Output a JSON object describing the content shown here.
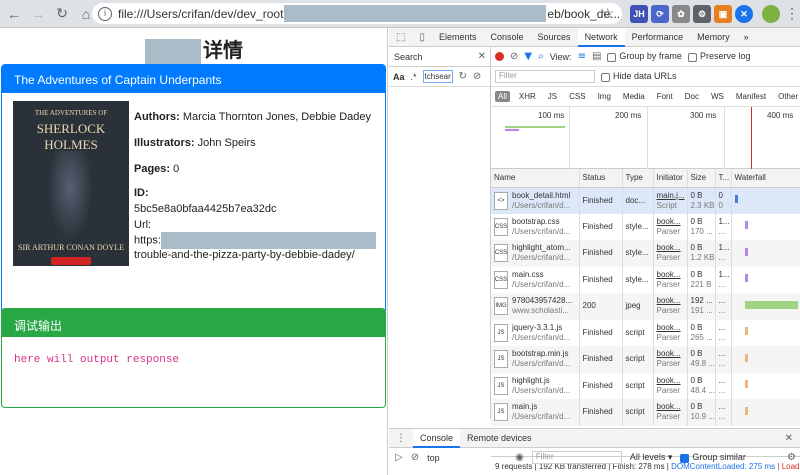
{
  "browser": {
    "url_prefix": "file:///Users/crifan/dev/dev_root",
    "url_suffix": "eb/book_de...",
    "ext_labels": [
      "JH",
      "⟳",
      "✿",
      "⚙",
      "▣",
      "✕"
    ]
  },
  "page": {
    "title": "详情",
    "book_card": {
      "header": "The Adventures of Captain Underpants",
      "cover": {
        "line1": "THE ADVENTURES OF",
        "line2": "SHERLOCK HOLMES",
        "line3": "SIR ARTHUR CONAN DOYLE"
      },
      "authors_label": "Authors:",
      "authors_value": "Marcia Thornton Jones, Debbie Dadey",
      "illustrators_label": "Illustrators:",
      "illustrators_value": "John Speirs",
      "pages_label": "Pages:",
      "pages_value": "0",
      "id_label": "ID:",
      "id_value": "5bc5e8a0bfaa4425b7ea32dc",
      "url_label": "Url:",
      "url_prefix": "https:",
      "url_suffix": "trouble-and-the-pizza-party-by-debbie-dadey/"
    },
    "debug_card": {
      "header": "调试输出",
      "body": "here will output response"
    }
  },
  "devtools": {
    "tabs": [
      "Elements",
      "Console",
      "Sources",
      "Network",
      "Performance",
      "Memory"
    ],
    "active_tab": "Network",
    "more": "»",
    "search": {
      "title": "Search",
      "aa": "Aa",
      "regex": ".*",
      "query": "tchsear"
    },
    "network": {
      "view_label": "View:",
      "group_by_frame": "Group by frame",
      "preserve_log": "Preserve log",
      "filter_placeholder": "Filter",
      "hide_data_urls": "Hide data URLs",
      "types": [
        "All",
        "XHR",
        "JS",
        "CSS",
        "Img",
        "Media",
        "Font",
        "Doc",
        "WS",
        "Manifest",
        "Other"
      ],
      "overview_ticks": [
        "100 ms",
        "200 ms",
        "300 ms",
        "400 ms"
      ],
      "columns": [
        "Name",
        "Status",
        "Type",
        "Initiator",
        "Size",
        "T...",
        "Waterfall"
      ],
      "rows": [
        {
          "icon": "<>",
          "name": "book_detail.html",
          "path": "/Users/crifan/d...",
          "status": "Finished",
          "type": "doc...",
          "init": "main.j...",
          "init2": "Script",
          "size": "0 B",
          "size2": "2.3 KB",
          "time": "0",
          "time2": "0",
          "bar_color": "#4a7fd0",
          "start": 0,
          "end": 0.5
        },
        {
          "icon": "CSS",
          "name": "bootstrap.css",
          "path": "/Users/crifan/d...",
          "status": "Finished",
          "type": "style...",
          "init": "book...",
          "init2": "Parser",
          "size": "0 B",
          "size2": "170 ...",
          "time": "1...",
          "time2": "...",
          "bar_color": "#b388e8",
          "start": 15,
          "end": 20
        },
        {
          "icon": "CSS",
          "name": "highlight_atom...",
          "path": "/Users/crifan/d...",
          "status": "Finished",
          "type": "style...",
          "init": "book...",
          "init2": "Parser",
          "size": "0 B",
          "size2": "1.2 KB",
          "time": "1...",
          "time2": "...",
          "bar_color": "#b388e8",
          "start": 15,
          "end": 20
        },
        {
          "icon": "CSS",
          "name": "main.css",
          "path": "/Users/crifan/d...",
          "status": "Finished",
          "type": "style...",
          "init": "book...",
          "init2": "Parser",
          "size": "0 B",
          "size2": "221 B",
          "time": "1...",
          "time2": "...",
          "bar_color": "#b388e8",
          "start": 15,
          "end": 20
        },
        {
          "icon": "IMG",
          "name": "978043957428...",
          "path": "www.scholasti...",
          "status": "200",
          "type": "jpeg",
          "init": "book...",
          "init2": "Parser",
          "size": "192 ...",
          "size2": "191 ...",
          "time": "...",
          "time2": "...",
          "bar_color": "#9fd483",
          "start": 15,
          "end": 95
        },
        {
          "icon": "JS",
          "name": "jquery-3.3.1.js",
          "path": "/Users/crifan/d...",
          "status": "Finished",
          "type": "script",
          "init": "book...",
          "init2": "Parser",
          "size": "0 B",
          "size2": "265 ...",
          "time": "...",
          "time2": "...",
          "bar_color": "#f4b17a",
          "start": 15,
          "end": 20
        },
        {
          "icon": "JS",
          "name": "bootstrap.min.js",
          "path": "/Users/crifan/d...",
          "status": "Finished",
          "type": "script",
          "init": "book...",
          "init2": "Parser",
          "size": "0 B",
          "size2": "49.8 ...",
          "time": "...",
          "time2": "...",
          "bar_color": "#f4b17a",
          "start": 15,
          "end": 20
        },
        {
          "icon": "JS",
          "name": "highlight.js",
          "path": "/Users/crifan/d...",
          "status": "Finished",
          "type": "script",
          "init": "book...",
          "init2": "Parser",
          "size": "0 B",
          "size2": "48.4 ...",
          "time": "...",
          "time2": "...",
          "bar_color": "#f4b17a",
          "start": 15,
          "end": 20
        },
        {
          "icon": "JS",
          "name": "main.js",
          "path": "/Users/crifan/d...",
          "status": "Finished",
          "type": "script",
          "init": "book...",
          "init2": "Parser",
          "size": "0 B",
          "size2": "10.9 ...",
          "time": "...",
          "time2": "...",
          "bar_color": "#f4b17a",
          "start": 15,
          "end": 20
        }
      ],
      "status_summary": "9 requests | 192 KB transferred | Finish: 278 ms |",
      "dom_loaded": "DOMContentLoaded: 275 ms",
      "load": "| Load: ..."
    },
    "drawer": {
      "tabs": [
        "Console",
        "Remote devices"
      ],
      "context": "top",
      "filter_placeholder": "Filter",
      "levels": "All levels ▾",
      "group_similar": "Group similar"
    }
  }
}
